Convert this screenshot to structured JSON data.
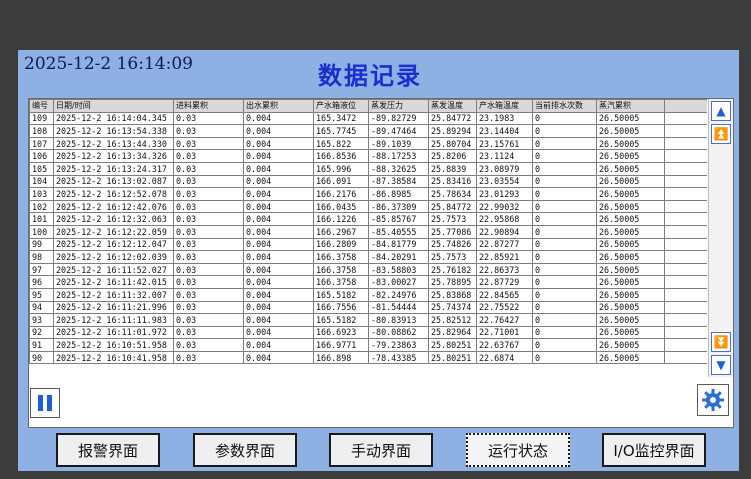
{
  "header": {
    "datetime": "2025-12-2  16:14:09",
    "title": "数据记录"
  },
  "table": {
    "columns": [
      "编号",
      "日期/时间",
      "进料累积",
      "出水累积",
      "产水箱液位",
      "蒸发压力",
      "蒸发温度",
      "产水箱温度",
      "当前排水次数",
      "蒸汽累积"
    ],
    "rows": [
      [
        "109",
        "2025-12-2  16:14:04.345",
        "0.03",
        "0.004",
        "165.3472",
        "-89.82729",
        "25.84772",
        "23.1983",
        "0",
        "26.50005"
      ],
      [
        "108",
        "2025-12-2  16:13:54.338",
        "0.03",
        "0.004",
        "165.7745",
        "-89.47464",
        "25.89294",
        "23.14404",
        "0",
        "26.50005"
      ],
      [
        "107",
        "2025-12-2  16:13:44.330",
        "0.03",
        "0.004",
        "165.822",
        "-89.1039",
        "25.80704",
        "23.15761",
        "0",
        "26.50005"
      ],
      [
        "106",
        "2025-12-2  16:13:34.326",
        "0.03",
        "0.004",
        "166.8536",
        "-88.17253",
        "25.8206",
        "23.1124",
        "0",
        "26.50005"
      ],
      [
        "105",
        "2025-12-2  16:13:24.317",
        "0.03",
        "0.004",
        "165.996",
        "-88.32625",
        "25.8839",
        "23.08979",
        "0",
        "26.50005"
      ],
      [
        "104",
        "2025-12-2  16:13:02.087",
        "0.03",
        "0.004",
        "166.091",
        "-87.38584",
        "25.83416",
        "23.03554",
        "0",
        "26.50005"
      ],
      [
        "103",
        "2025-12-2  16:12:52.078",
        "0.03",
        "0.004",
        "166.2176",
        "-86.8985",
        "25.78634",
        "23.01293",
        "0",
        "26.50005"
      ],
      [
        "102",
        "2025-12-2  16:12:42.076",
        "0.03",
        "0.004",
        "166.0435",
        "-86.37309",
        "25.84772",
        "22.99032",
        "0",
        "26.50005"
      ],
      [
        "101",
        "2025-12-2  16:12:32.063",
        "0.03",
        "0.004",
        "166.1226",
        "-85.85767",
        "25.7573",
        "22.95868",
        "0",
        "26.50005"
      ],
      [
        "100",
        "2025-12-2  16:12:22.059",
        "0.03",
        "0.004",
        "166.2967",
        "-85.40555",
        "25.77086",
        "22.90894",
        "0",
        "26.50005"
      ],
      [
        "99",
        "2025-12-2  16:12:12.047",
        "0.03",
        "0.004",
        "166.2809",
        "-84.81779",
        "25.74826",
        "22.87277",
        "0",
        "26.50005"
      ],
      [
        "98",
        "2025-12-2  16:12:02.039",
        "0.03",
        "0.004",
        "166.3758",
        "-84.20291",
        "25.7573",
        "22.85921",
        "0",
        "26.50005"
      ],
      [
        "97",
        "2025-12-2  16:11:52.027",
        "0.03",
        "0.004",
        "166.3758",
        "-83.58803",
        "25.76182",
        "22.86373",
        "0",
        "26.50005"
      ],
      [
        "96",
        "2025-12-2  16:11:42.015",
        "0.03",
        "0.004",
        "166.3758",
        "-83.00027",
        "25.78895",
        "22.87729",
        "0",
        "26.50005"
      ],
      [
        "95",
        "2025-12-2  16:11:32.007",
        "0.03",
        "0.004",
        "165.5182",
        "-82.24976",
        "25.83868",
        "22.84565",
        "0",
        "26.50005"
      ],
      [
        "94",
        "2025-12-2  16:11:21.996",
        "0.03",
        "0.004",
        "166.7556",
        "-81.54444",
        "25.74374",
        "22.75522",
        "0",
        "26.50005"
      ],
      [
        "93",
        "2025-12-2  16:11:11.983",
        "0.03",
        "0.004",
        "165.5182",
        "-80.83913",
        "25.82512",
        "22.76427",
        "0",
        "26.50005"
      ],
      [
        "92",
        "2025-12-2  16:11:01.972",
        "0.03",
        "0.004",
        "166.6923",
        "-80.08862",
        "25.82964",
        "22.71001",
        "0",
        "26.50005"
      ],
      [
        "91",
        "2025-12-2  16:10:51.958",
        "0.03",
        "0.004",
        "166.9771",
        "-79.23863",
        "25.80251",
        "22.63767",
        "0",
        "26.50005"
      ],
      [
        "90",
        "2025-12-2  16:10:41.958",
        "0.03",
        "0.004",
        "166.898",
        "-78.43385",
        "25.80251",
        "22.6874",
        "0",
        "26.50005"
      ]
    ]
  },
  "icons": {
    "scroll_up": "▲",
    "page_up": "⏫",
    "page_down": "⏬",
    "scroll_down": "▼",
    "pause": "pause-icon",
    "settings": "gear-icon"
  },
  "nav": {
    "alarm": "报警界面",
    "params": "参数界面",
    "manual": "手动界面",
    "status": "运行状态",
    "io": "I/O监控界面"
  },
  "colors": {
    "panel": "#8fb0e3",
    "title": "#1a2fd1",
    "scroll_icon": "#1e5fd6"
  }
}
